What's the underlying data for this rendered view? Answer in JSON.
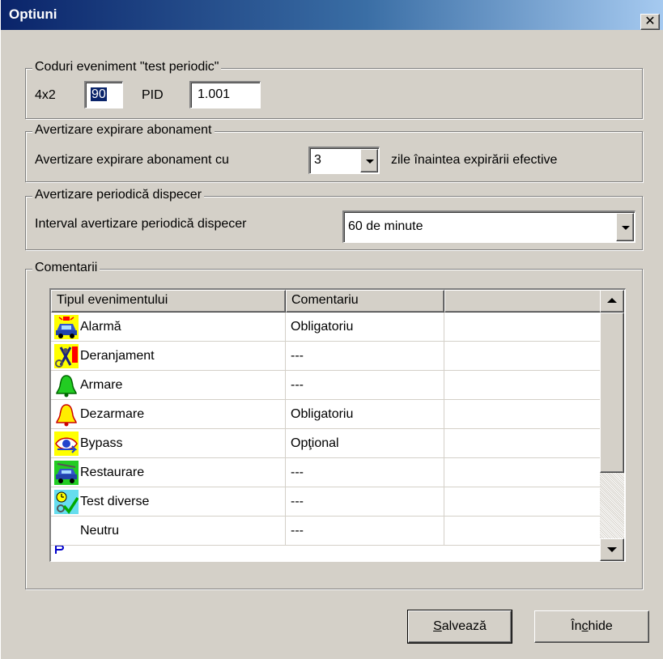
{
  "window": {
    "title": "Optiuni",
    "close_glyph": "✕"
  },
  "group_test": {
    "title": "Coduri eveniment \"test periodic\"",
    "label_4x2": "4x2",
    "value_4x2": "90",
    "label_pid": "PID",
    "value_pid": "1.001"
  },
  "group_expiry": {
    "title": "Avertizare expirare abonament",
    "label": "Avertizare expirare abonament cu",
    "value": "3",
    "suffix": "zile înaintea expirării efective"
  },
  "group_dispatch": {
    "title": "Avertizare periodică dispecer",
    "label": "Interval avertizare periodică dispecer",
    "value": "60 de minute"
  },
  "group_comments": {
    "title": "Comentarii",
    "columns": [
      "Tipul evenimentului",
      "Comentariu",
      ""
    ],
    "rows": [
      {
        "type": "Alarmă",
        "comment": "Obligatoriu",
        "icon": "alarm-car-icon"
      },
      {
        "type": "Deranjament",
        "comment": "---",
        "icon": "tools-icon"
      },
      {
        "type": "Armare",
        "comment": "---",
        "icon": "green-bell-icon"
      },
      {
        "type": "Dezarmare",
        "comment": "Obligatoriu",
        "icon": "yellow-bell-icon"
      },
      {
        "type": "Bypass",
        "comment": "Opţional",
        "icon": "bypass-eye-icon"
      },
      {
        "type": "Restaurare",
        "comment": "---",
        "icon": "restore-car-icon"
      },
      {
        "type": "Test diverse",
        "comment": "---",
        "icon": "test-check-icon"
      },
      {
        "type": "Neutru",
        "comment": "---",
        "icon": ""
      }
    ]
  },
  "buttons": {
    "save_mnemonic": "S",
    "save_rest": "alvează",
    "close_a": "În",
    "close_mnemonic": "c",
    "close_b": "hide"
  },
  "colors": {
    "face": "#d4d0c8",
    "title_start": "#0a246a",
    "title_end": "#a6caf0",
    "selection": "#0a246a"
  }
}
